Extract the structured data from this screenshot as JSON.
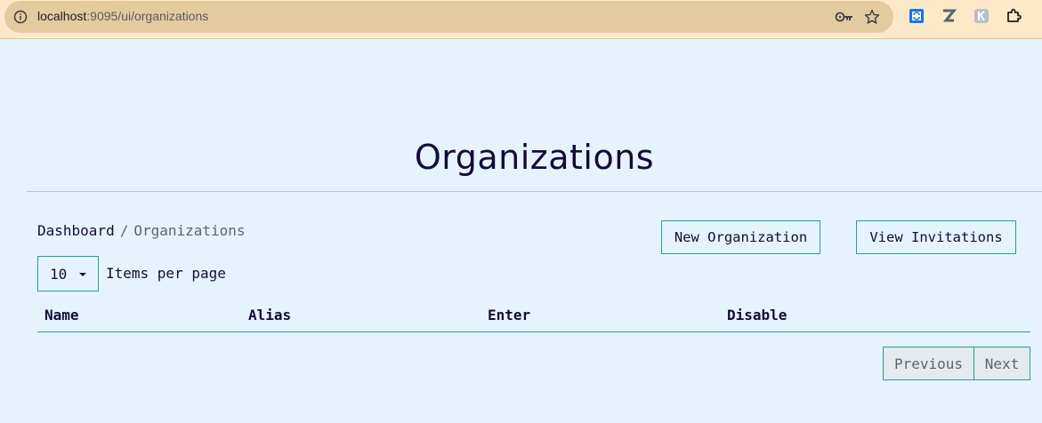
{
  "browser": {
    "url_host": "localhost",
    "url_path": ":9095/ui/organizations"
  },
  "page": {
    "title": "Organizations",
    "breadcrumb": {
      "link": "Dashboard",
      "separator": "/",
      "current": "Organizations"
    },
    "actions": {
      "new_organization": "New Organization",
      "view_invitations": "View Invitations"
    },
    "pagination_size": {
      "selected": "10",
      "label": "Items per page"
    },
    "table": {
      "columns": [
        "Name",
        "Alias",
        "Enter",
        "Disable"
      ]
    },
    "pager": {
      "previous": "Previous",
      "next": "Next"
    }
  },
  "colors": {
    "background": "#e5f3fd",
    "accent": "#2a9d8f",
    "text": "#150b36",
    "browser_bar": "#fde9c7"
  }
}
